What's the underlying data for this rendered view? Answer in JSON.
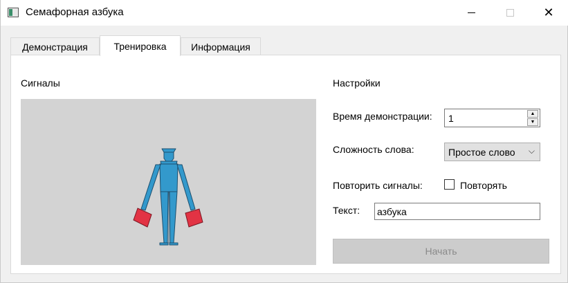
{
  "window": {
    "title": "Семафорная азбука",
    "icon": "app-window-icon",
    "controls": {
      "minimize": "minimize-icon",
      "maximize": "maximize-icon",
      "close": "close-icon"
    }
  },
  "tabs": [
    {
      "label": "Демонстрация",
      "active": false
    },
    {
      "label": "Тренировка",
      "active": true
    },
    {
      "label": "Информация",
      "active": false
    }
  ],
  "signals": {
    "title": "Сигналы",
    "figure": "semaphore-sailor-with-red-flags",
    "colors": {
      "canvas": "#d3d3d3",
      "sailor": "#3399cc",
      "flag": "#e23344"
    }
  },
  "settings": {
    "title": "Настройки",
    "time_label": "Время демонстрации:",
    "time_value": "1",
    "difficulty_label": "Сложность слова:",
    "difficulty_value": "Простое слово",
    "repeat_label": "Повторить сигналы:",
    "repeat_checkbox_label": "Повторять",
    "repeat_checked": false,
    "text_label": "Текст:",
    "text_value": "азбука",
    "start_label": "Начать",
    "start_enabled": false
  }
}
